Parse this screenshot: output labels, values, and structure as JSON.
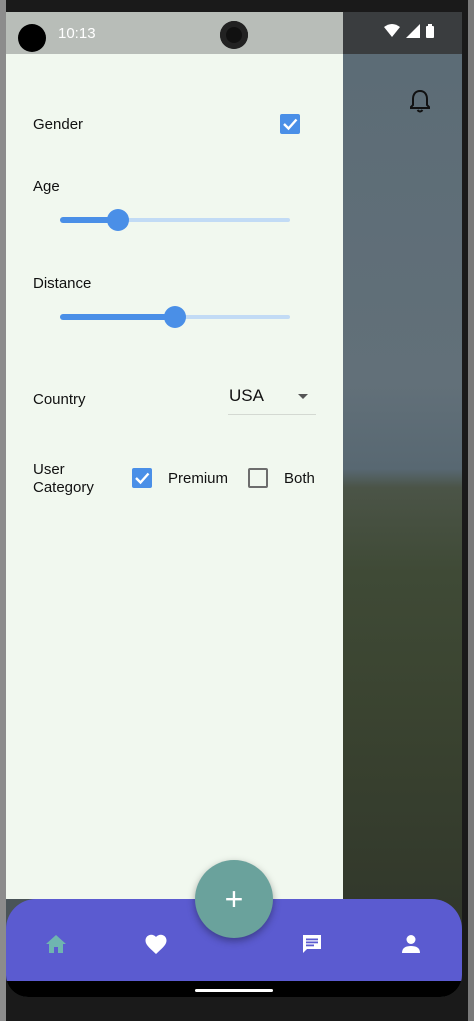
{
  "status_bar": {
    "time": "10:13"
  },
  "filters": {
    "gender": {
      "label": "Gender",
      "checked": true
    },
    "age": {
      "label": "Age",
      "value_fraction": 0.25
    },
    "distance": {
      "label": "Distance",
      "value_fraction": 0.5
    },
    "country": {
      "label": "Country",
      "selected": "USA"
    },
    "user_category": {
      "label_line1": "User",
      "label_line2": "Category",
      "options": [
        {
          "label": "Premium",
          "checked": true
        },
        {
          "label": "Both",
          "checked": false
        }
      ]
    }
  },
  "fab": {
    "label": "+"
  },
  "bottom_nav": {
    "items": [
      {
        "icon": "home-icon",
        "active": true
      },
      {
        "icon": "heart-icon",
        "active": false
      },
      {
        "icon": "chat-icon",
        "active": false
      },
      {
        "icon": "person-icon",
        "active": false
      }
    ],
    "colors": {
      "background": "#5b5bd0",
      "active": "#6fb5b0",
      "inactive": "#ffffff"
    }
  },
  "colors": {
    "accent": "#4a8fe7",
    "drawer_bg": "#f1f8ef",
    "fab": "#6aa29c"
  }
}
